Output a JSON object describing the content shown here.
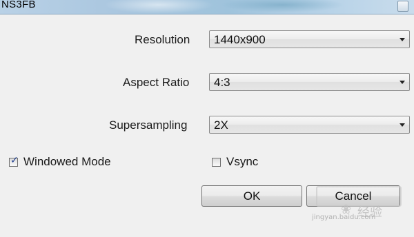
{
  "window": {
    "title": "NS3FB"
  },
  "settings": {
    "resolution": {
      "label": "Resolution",
      "value": "1440x900"
    },
    "aspect_ratio": {
      "label": "Aspect Ratio",
      "value": "4:3"
    },
    "supersampling": {
      "label": "Supersampling",
      "value": "2X"
    }
  },
  "options": {
    "windowed_mode": {
      "label": "Windowed Mode",
      "checked": true
    },
    "vsync": {
      "label": "Vsync",
      "checked": false
    }
  },
  "buttons": {
    "ok_label": "OK",
    "cancel_label": "Cancel"
  },
  "watermark": {
    "brand_text": "经验",
    "url": "jingyan.baidu.com"
  }
}
